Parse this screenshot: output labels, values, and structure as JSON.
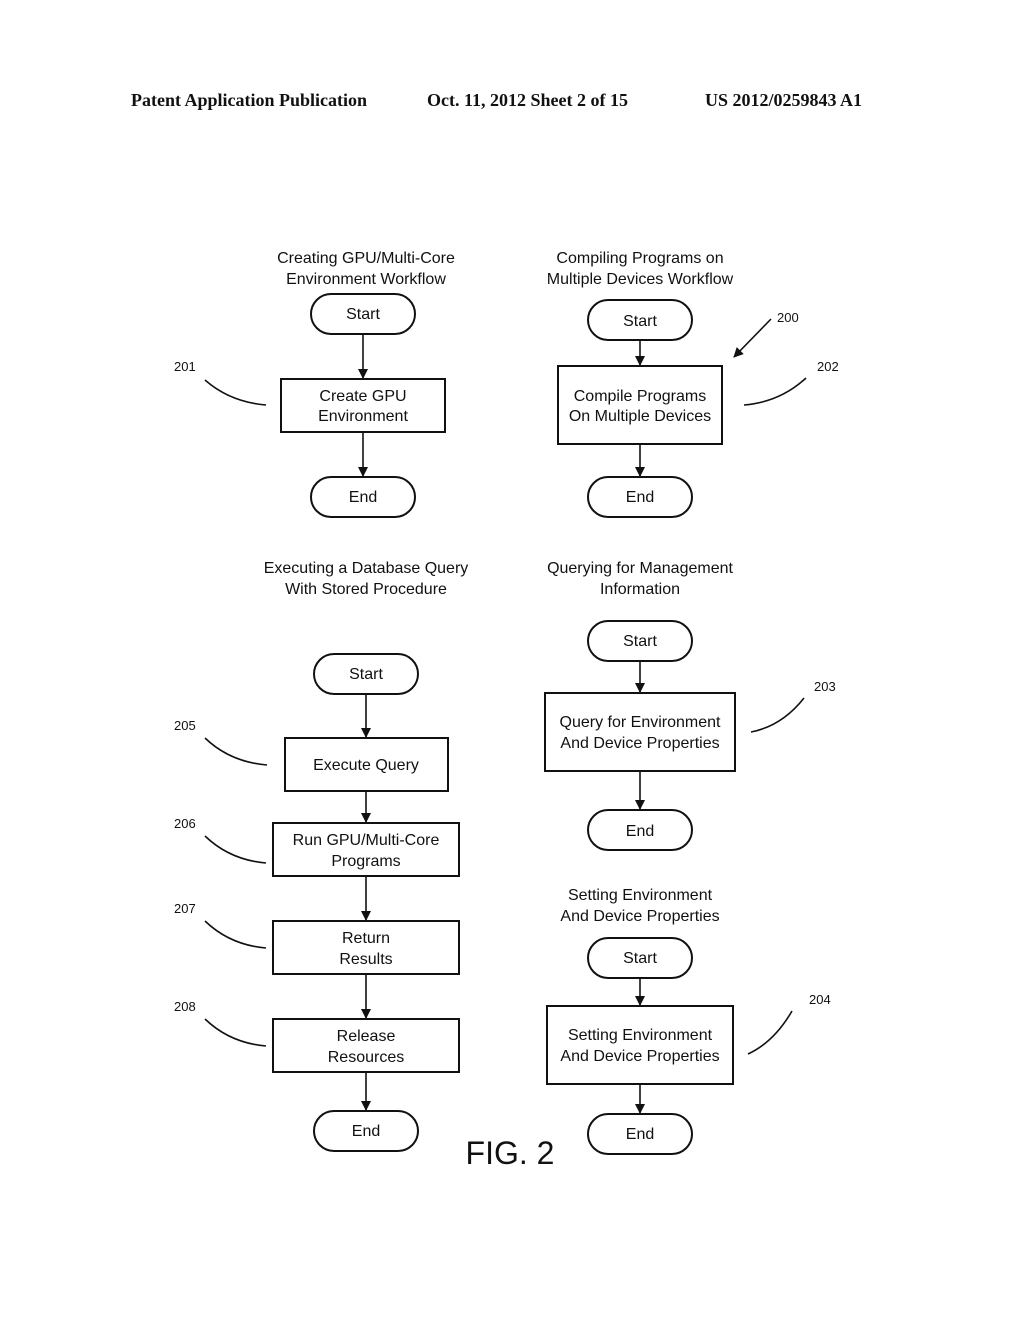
{
  "header": {
    "publication": "Patent Application Publication",
    "date_sheet": "Oct. 11, 2012   Sheet 2 of 15",
    "number": "US 2012/0259843 A1"
  },
  "figure": {
    "ref_main": "200",
    "caption": "FIG. 2",
    "workflows": [
      {
        "title": [
          "Creating GPU/Multi-Core",
          "Environment Workflow"
        ],
        "start": "Start",
        "steps": [
          {
            "ref": "201",
            "lines": [
              "Create GPU",
              "Environment"
            ]
          }
        ],
        "end": "End"
      },
      {
        "title": [
          "Compiling Programs on",
          "Multiple Devices Workflow"
        ],
        "start": "Start",
        "steps": [
          {
            "ref": "202",
            "lines": [
              "Compile Programs",
              "On Multiple Devices"
            ]
          }
        ],
        "end": "End"
      },
      {
        "title": [
          "Executing a Database Query",
          "With Stored Procedure"
        ],
        "start": "Start",
        "steps": [
          {
            "ref": "205",
            "lines": [
              "Execute Query"
            ]
          },
          {
            "ref": "206",
            "lines": [
              "Run GPU/Multi-Core",
              "Programs"
            ]
          },
          {
            "ref": "207",
            "lines": [
              "Return",
              "Results"
            ]
          },
          {
            "ref": "208",
            "lines": [
              "Release",
              "Resources"
            ]
          }
        ],
        "end": "End"
      },
      {
        "title": [
          "Querying  for Management",
          "Information"
        ],
        "start": "Start",
        "steps": [
          {
            "ref": "203",
            "lines": [
              "Query  for Environment",
              "And Device Properties"
            ]
          }
        ],
        "end": "End"
      },
      {
        "title": [
          "Setting Environment",
          "And Device Properties"
        ],
        "start": "Start",
        "steps": [
          {
            "ref": "204",
            "lines": [
              "Setting Environment",
              "And Device Properties"
            ]
          }
        ],
        "end": "End"
      }
    ]
  }
}
